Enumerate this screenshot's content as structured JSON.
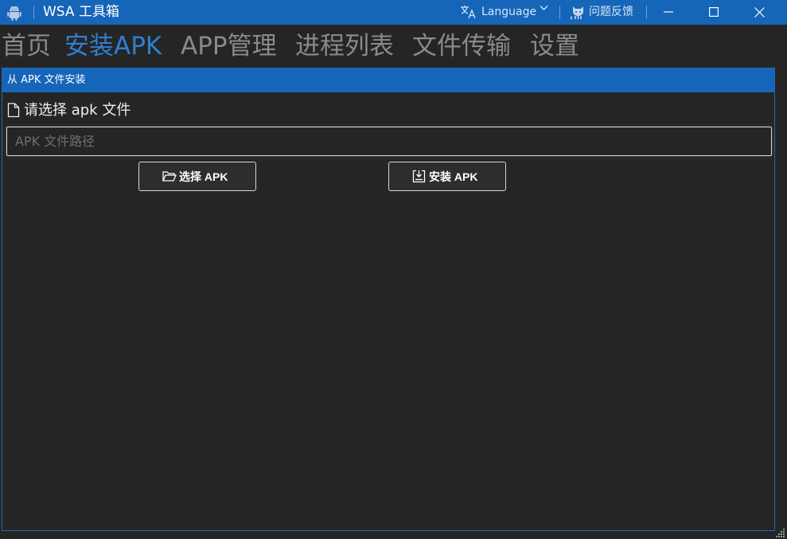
{
  "titlebar": {
    "app_name": "WSA 工具箱",
    "language_label": "Language",
    "feedback_label": "问题反馈"
  },
  "tabs": [
    {
      "label": "首页",
      "active": false
    },
    {
      "label": "安装APK",
      "active": true
    },
    {
      "label": "APP管理",
      "active": false
    },
    {
      "label": "进程列表",
      "active": false
    },
    {
      "label": "文件传输",
      "active": false
    },
    {
      "label": "设置",
      "active": false
    }
  ],
  "panel": {
    "header": "从 APK 文件安装",
    "section_label": "请选择 apk 文件",
    "path_input": {
      "value": "",
      "placeholder": "APK 文件路径"
    },
    "select_button": "选择 APK",
    "install_button": "安装 APK"
  },
  "colors": {
    "accent": "#1565b8",
    "active_tab": "#2f7fd0",
    "inactive_tab": "#8a8a8a",
    "background": "#252525"
  },
  "icons": {
    "app": "android-icon",
    "language": "translate-icon",
    "feedback": "github-cat-icon",
    "section": "file-icon",
    "select": "folder-open-icon",
    "install": "download-icon"
  }
}
